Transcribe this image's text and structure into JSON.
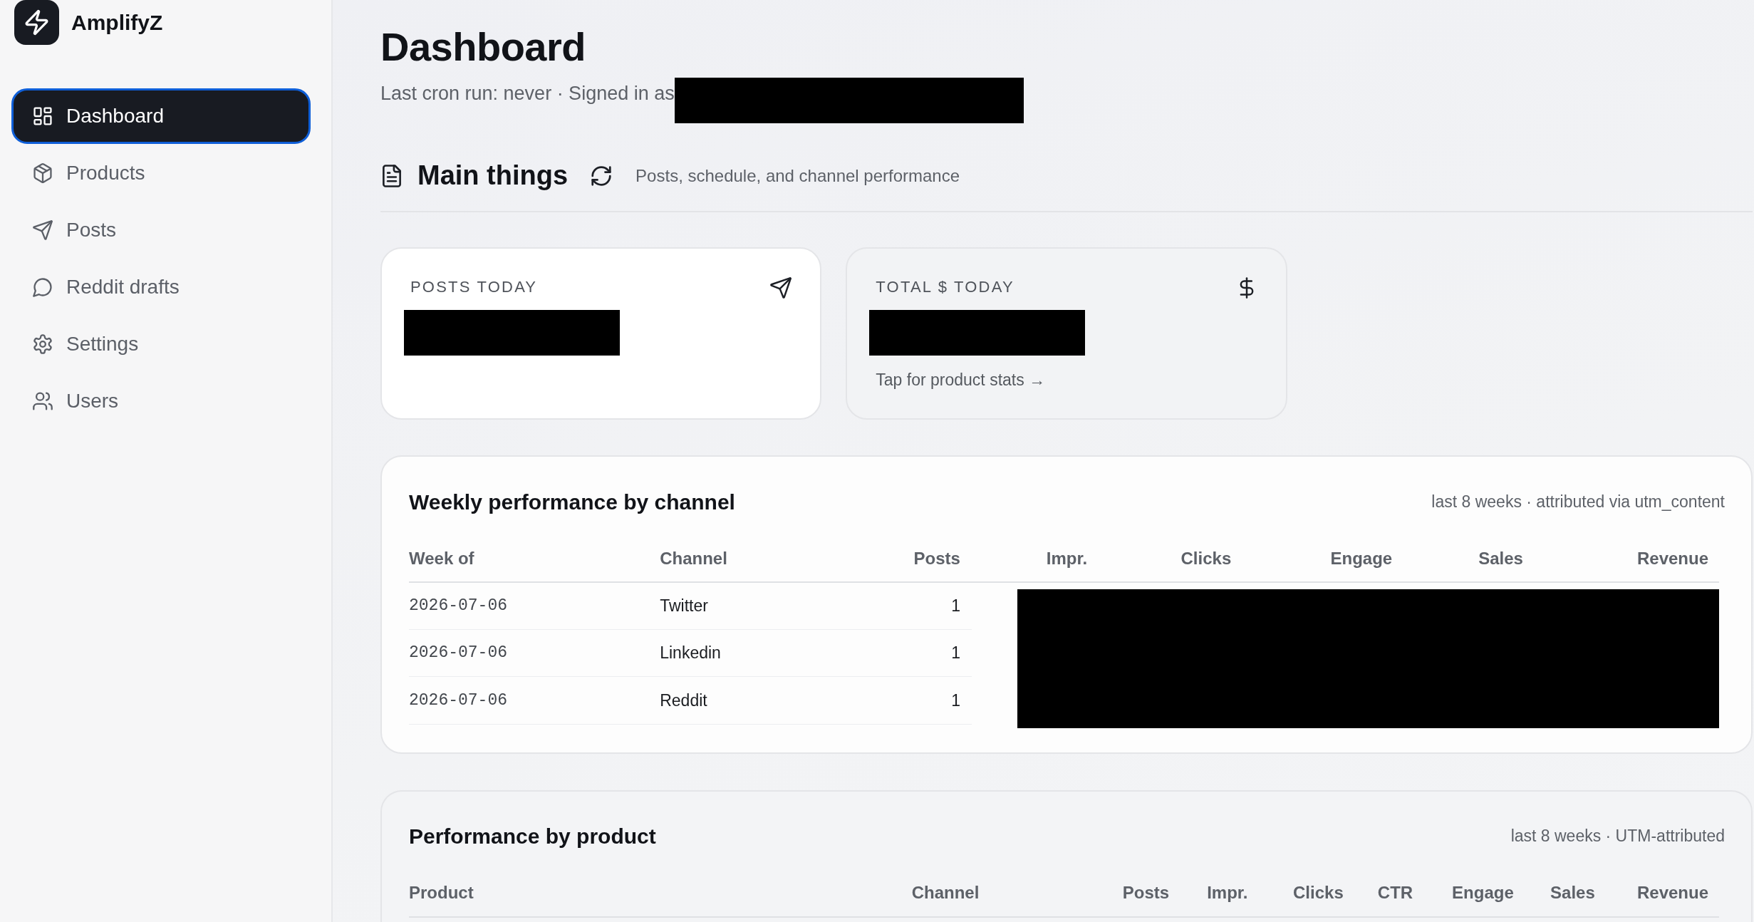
{
  "sidebar": {
    "brand": "AmplifyZ",
    "items": [
      {
        "label": "Dashboard",
        "selected": true
      },
      {
        "label": "Products",
        "selected": false
      },
      {
        "label": "Posts",
        "selected": false
      },
      {
        "label": "Reddit drafts",
        "selected": false
      },
      {
        "label": "Settings",
        "selected": false
      },
      {
        "label": "Users",
        "selected": false
      }
    ]
  },
  "header": {
    "title": "Dashboard",
    "subtitle": "Last cron run: never · Signed in as",
    "signed_in_redacted": true
  },
  "section": {
    "title": "Main things",
    "description": "Posts, schedule, and channel performance"
  },
  "stat_cards": [
    {
      "kind": "plain",
      "label": "POSTS TODAY",
      "value_redacted": true
    },
    {
      "kind": "link",
      "label": "TOTAL $ TODAY",
      "value_redacted": true,
      "hint": "Tap for product stats →"
    }
  ],
  "tables": [
    {
      "title": "Weekly performance by channel",
      "note": "last 8 weeks · attributed via utm_content",
      "columns": [
        {
          "label": "Week of",
          "kind": "date"
        },
        {
          "label": "Channel",
          "kind": "text"
        },
        {
          "label": "Posts",
          "kind": "number"
        },
        {
          "label": "Impr.",
          "kind": "number"
        },
        {
          "label": "Clicks",
          "kind": "number"
        },
        {
          "label": "Engage",
          "kind": "number"
        },
        {
          "label": "Sales",
          "kind": "number"
        },
        {
          "label": "Revenue",
          "kind": "number"
        }
      ],
      "rows": [
        [
          "2026-07-06",
          "Twitter",
          "1"
        ],
        [
          "2026-07-06",
          "Linkedin",
          "1"
        ],
        [
          "2026-07-06",
          "Reddit",
          "1"
        ]
      ],
      "metrics_redacted": true
    },
    {
      "title": "Performance by product",
      "note": "last 8 weeks · UTM-attributed",
      "columns": [
        {
          "label": "Product",
          "kind": "text"
        },
        {
          "label": "Channel",
          "kind": "text"
        },
        {
          "label": "Posts",
          "kind": "number"
        },
        {
          "label": "Impr.",
          "kind": "number"
        },
        {
          "label": "Clicks",
          "kind": "number"
        },
        {
          "label": "CTR",
          "kind": "number"
        },
        {
          "label": "Engage",
          "kind": "number"
        },
        {
          "label": "Sales",
          "kind": "number"
        },
        {
          "label": "Revenue",
          "kind": "number"
        }
      ]
    }
  ]
}
